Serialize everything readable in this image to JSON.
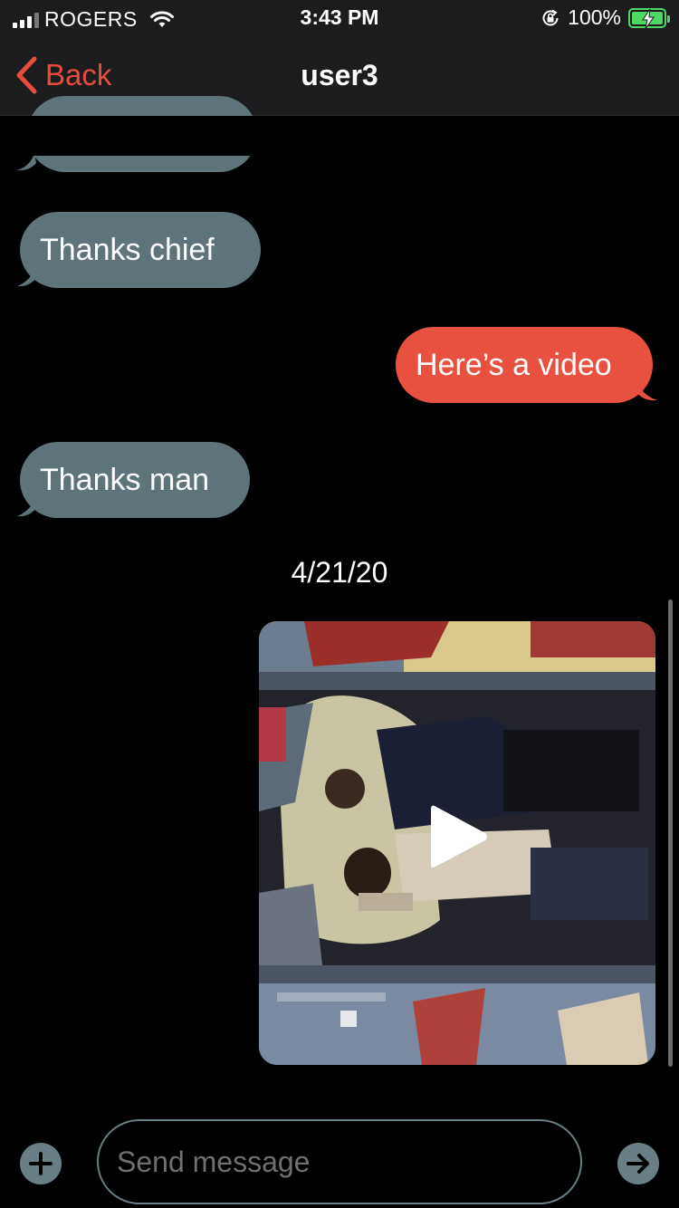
{
  "status_bar": {
    "carrier": "ROGERS",
    "time": "3:43 PM",
    "battery_percent": "100%",
    "signal_bars": 4,
    "signal_bars_active": 3,
    "icons": [
      "signal-icon",
      "wifi-icon",
      "orientation-lock-icon",
      "battery-charging-icon"
    ]
  },
  "nav": {
    "back_label": "Back",
    "title": "user3",
    "back_icon": "chevron-left-icon"
  },
  "messages": [
    {
      "direction": "incoming",
      "text": ""
    },
    {
      "direction": "incoming",
      "text": "Thanks chief"
    },
    {
      "direction": "outgoing",
      "text": "Here’s a video"
    },
    {
      "direction": "incoming",
      "text": "Thanks man"
    }
  ],
  "date_separator": "4/21/20",
  "video_message": {
    "direction": "outgoing",
    "icon": "play-icon"
  },
  "composer": {
    "placeholder": "Send message",
    "value": "",
    "add_icon": "plus-icon",
    "send_icon": "arrow-right-icon"
  },
  "colors": {
    "accent": "#e74c3c",
    "outgoing_bubble": "#e85140",
    "incoming_bubble": "#5f737b",
    "bar_background": "#1c1c1e",
    "background": "#000000"
  }
}
